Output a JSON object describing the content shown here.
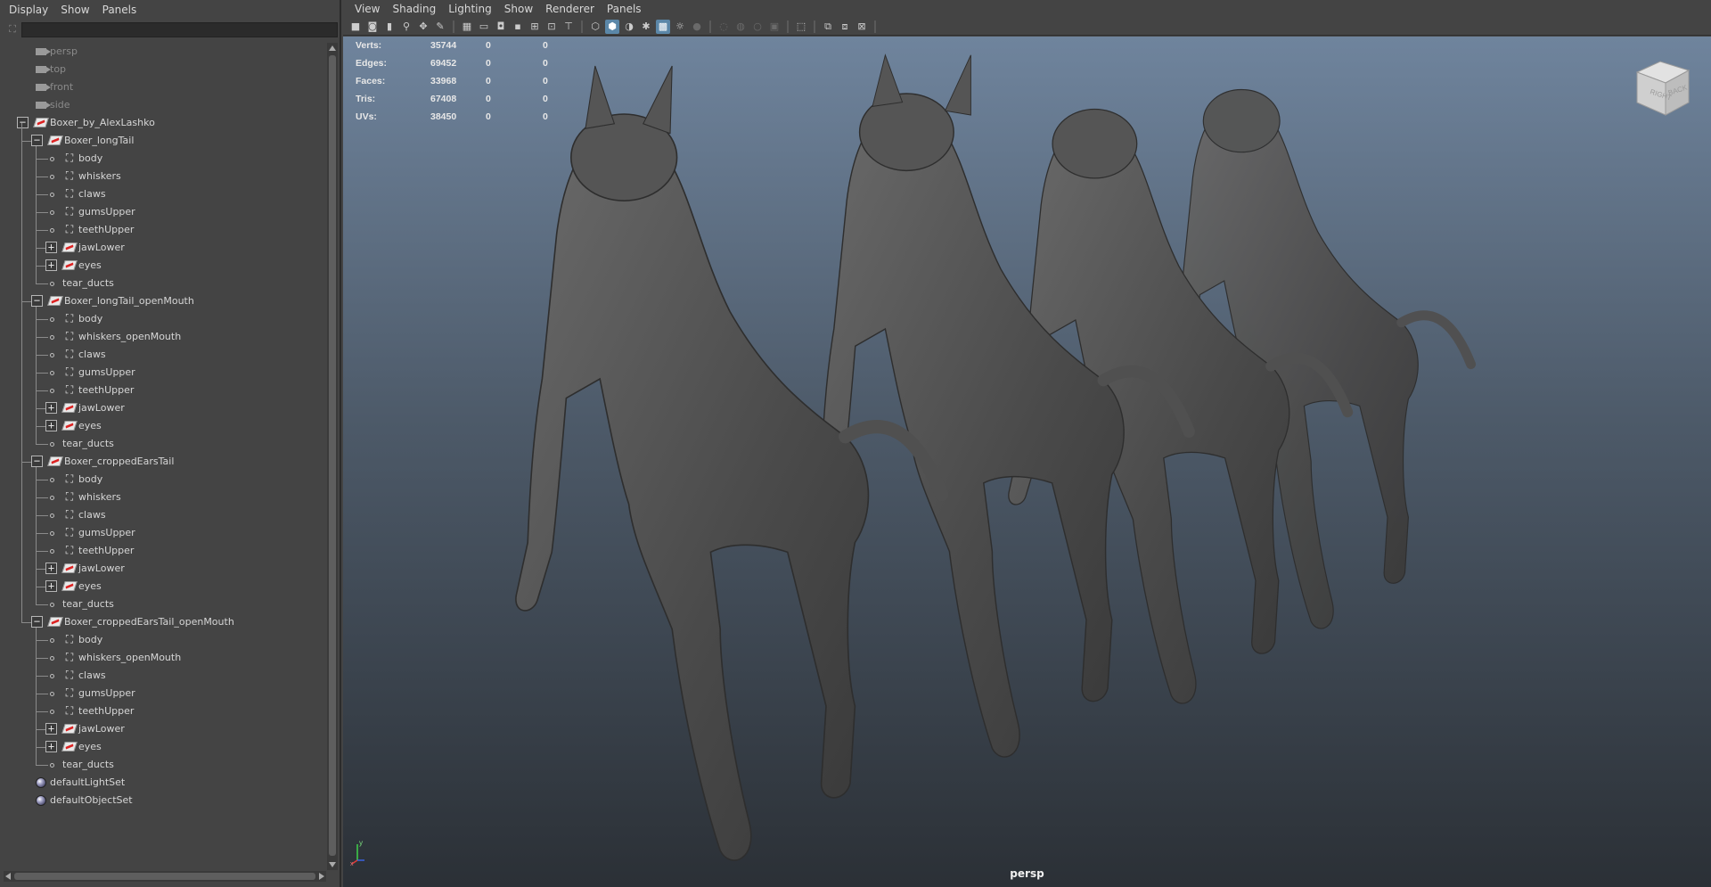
{
  "outliner": {
    "menu": [
      "Display",
      "Show",
      "Panels"
    ],
    "tree": [
      {
        "label": "persp",
        "kind": "camera",
        "depth": 0
      },
      {
        "label": "top",
        "kind": "camera",
        "depth": 0
      },
      {
        "label": "front",
        "kind": "camera",
        "depth": 0
      },
      {
        "label": "side",
        "kind": "camera",
        "depth": 0
      },
      {
        "label": "Boxer_by_AlexLashko",
        "kind": "group",
        "depth": 0,
        "toggle": "minus"
      },
      {
        "label": "Boxer_longTail",
        "kind": "group",
        "depth": 1,
        "toggle": "minus"
      },
      {
        "label": "body",
        "kind": "mesh",
        "depth": 2
      },
      {
        "label": "whiskers",
        "kind": "mesh",
        "depth": 2
      },
      {
        "label": "claws",
        "kind": "mesh",
        "depth": 2
      },
      {
        "label": "gumsUpper",
        "kind": "mesh",
        "depth": 2
      },
      {
        "label": "teethUpper",
        "kind": "mesh",
        "depth": 2
      },
      {
        "label": "jawLower",
        "kind": "group",
        "depth": 2,
        "toggle": "plus"
      },
      {
        "label": "eyes",
        "kind": "group",
        "depth": 2,
        "toggle": "plus"
      },
      {
        "label": "tear_ducts",
        "kind": "leaf",
        "depth": 2
      },
      {
        "label": "Boxer_longTail_openMouth",
        "kind": "group",
        "depth": 1,
        "toggle": "minus"
      },
      {
        "label": "body",
        "kind": "mesh",
        "depth": 2
      },
      {
        "label": "whiskers_openMouth",
        "kind": "mesh",
        "depth": 2
      },
      {
        "label": "claws",
        "kind": "mesh",
        "depth": 2
      },
      {
        "label": "gumsUpper",
        "kind": "mesh",
        "depth": 2
      },
      {
        "label": "teethUpper",
        "kind": "mesh",
        "depth": 2
      },
      {
        "label": "jawLower",
        "kind": "group",
        "depth": 2,
        "toggle": "plus"
      },
      {
        "label": "eyes",
        "kind": "group",
        "depth": 2,
        "toggle": "plus"
      },
      {
        "label": "tear_ducts",
        "kind": "leaf",
        "depth": 2
      },
      {
        "label": "Boxer_croppedEarsTail",
        "kind": "group",
        "depth": 1,
        "toggle": "minus"
      },
      {
        "label": "body",
        "kind": "mesh",
        "depth": 2
      },
      {
        "label": "whiskers",
        "kind": "mesh",
        "depth": 2
      },
      {
        "label": "claws",
        "kind": "mesh",
        "depth": 2
      },
      {
        "label": "gumsUpper",
        "kind": "mesh",
        "depth": 2
      },
      {
        "label": "teethUpper",
        "kind": "mesh",
        "depth": 2
      },
      {
        "label": "jawLower",
        "kind": "group",
        "depth": 2,
        "toggle": "plus"
      },
      {
        "label": "eyes",
        "kind": "group",
        "depth": 2,
        "toggle": "plus"
      },
      {
        "label": "tear_ducts",
        "kind": "leaf",
        "depth": 2
      },
      {
        "label": "Boxer_croppedEarsTail_openMouth",
        "kind": "group",
        "depth": 1,
        "toggle": "minus"
      },
      {
        "label": "body",
        "kind": "mesh",
        "depth": 2
      },
      {
        "label": "whiskers_openMouth",
        "kind": "mesh",
        "depth": 2
      },
      {
        "label": "claws",
        "kind": "mesh",
        "depth": 2
      },
      {
        "label": "gumsUpper",
        "kind": "mesh",
        "depth": 2
      },
      {
        "label": "teethUpper",
        "kind": "mesh",
        "depth": 2
      },
      {
        "label": "jawLower",
        "kind": "group",
        "depth": 2,
        "toggle": "plus"
      },
      {
        "label": "eyes",
        "kind": "group",
        "depth": 2,
        "toggle": "plus"
      },
      {
        "label": "tear_ducts",
        "kind": "leaf",
        "depth": 2
      },
      {
        "label": "defaultLightSet",
        "kind": "set",
        "depth": 0
      },
      {
        "label": "defaultObjectSet",
        "kind": "set",
        "depth": 0
      }
    ]
  },
  "viewport": {
    "menu": [
      "View",
      "Shading",
      "Lighting",
      "Show",
      "Renderer",
      "Panels"
    ],
    "hud": [
      {
        "label": "Verts:",
        "total": "35744",
        "sel1": "0",
        "sel2": "0"
      },
      {
        "label": "Edges:",
        "total": "69452",
        "sel1": "0",
        "sel2": "0"
      },
      {
        "label": "Faces:",
        "total": "33968",
        "sel1": "0",
        "sel2": "0"
      },
      {
        "label": "Tris:",
        "total": "67408",
        "sel1": "0",
        "sel2": "0"
      },
      {
        "label": "UVs:",
        "total": "38450",
        "sel1": "0",
        "sel2": "0"
      }
    ],
    "viewcube": {
      "face1": "RIGHT",
      "face2": "BACK"
    },
    "camera_label": "persp",
    "axis": {
      "y": "y",
      "x": "x"
    }
  },
  "colors": {
    "accent": "#5b87a8",
    "panel": "#444444",
    "model": "#5a5a5a"
  }
}
